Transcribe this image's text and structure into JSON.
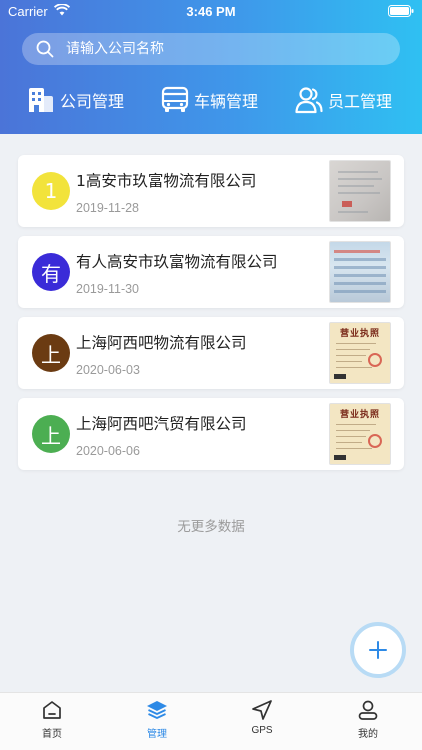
{
  "status_bar": {
    "carrier": "Carrier",
    "time": "3:46 PM"
  },
  "search": {
    "placeholder": "请输入公司名称"
  },
  "top_tabs": [
    {
      "label": "公司管理",
      "icon": "building-icon"
    },
    {
      "label": "车辆管理",
      "icon": "truck-icon"
    },
    {
      "label": "员工管理",
      "icon": "users-icon"
    }
  ],
  "companies": [
    {
      "avatar_text": "1",
      "avatar_color": "#f2e33b",
      "name": "1高安市玖富物流有限公司",
      "date": "2019-11-28",
      "thumb": "license-photo-gray"
    },
    {
      "avatar_text": "有",
      "avatar_color": "#3a2bd8",
      "name": "有人高安市玖富物流有限公司",
      "date": "2019-11-30",
      "thumb": "license-photo-blue"
    },
    {
      "avatar_text": "上",
      "avatar_color": "#6b3b12",
      "name": "上海阿西吧物流有限公司",
      "date": "2020-06-03",
      "thumb": "business-license"
    },
    {
      "avatar_text": "上",
      "avatar_color": "#4cae52",
      "name": "上海阿西吧汽贸有限公司",
      "date": "2020-06-06",
      "thumb": "business-license"
    }
  ],
  "license_title": "营业执照",
  "no_more_text": "无更多数据",
  "fab": {
    "icon": "plus-icon"
  },
  "tabbar": [
    {
      "label": "首页",
      "icon": "home-icon"
    },
    {
      "label": "管理",
      "icon": "layers-icon",
      "active": true
    },
    {
      "label": "GPS",
      "icon": "navigation-icon"
    },
    {
      "label": "我的",
      "icon": "user-icon"
    }
  ],
  "colors": {
    "accent": "#2e8ae6",
    "header_start": "#4b74d8",
    "header_end": "#2fc0f2"
  }
}
